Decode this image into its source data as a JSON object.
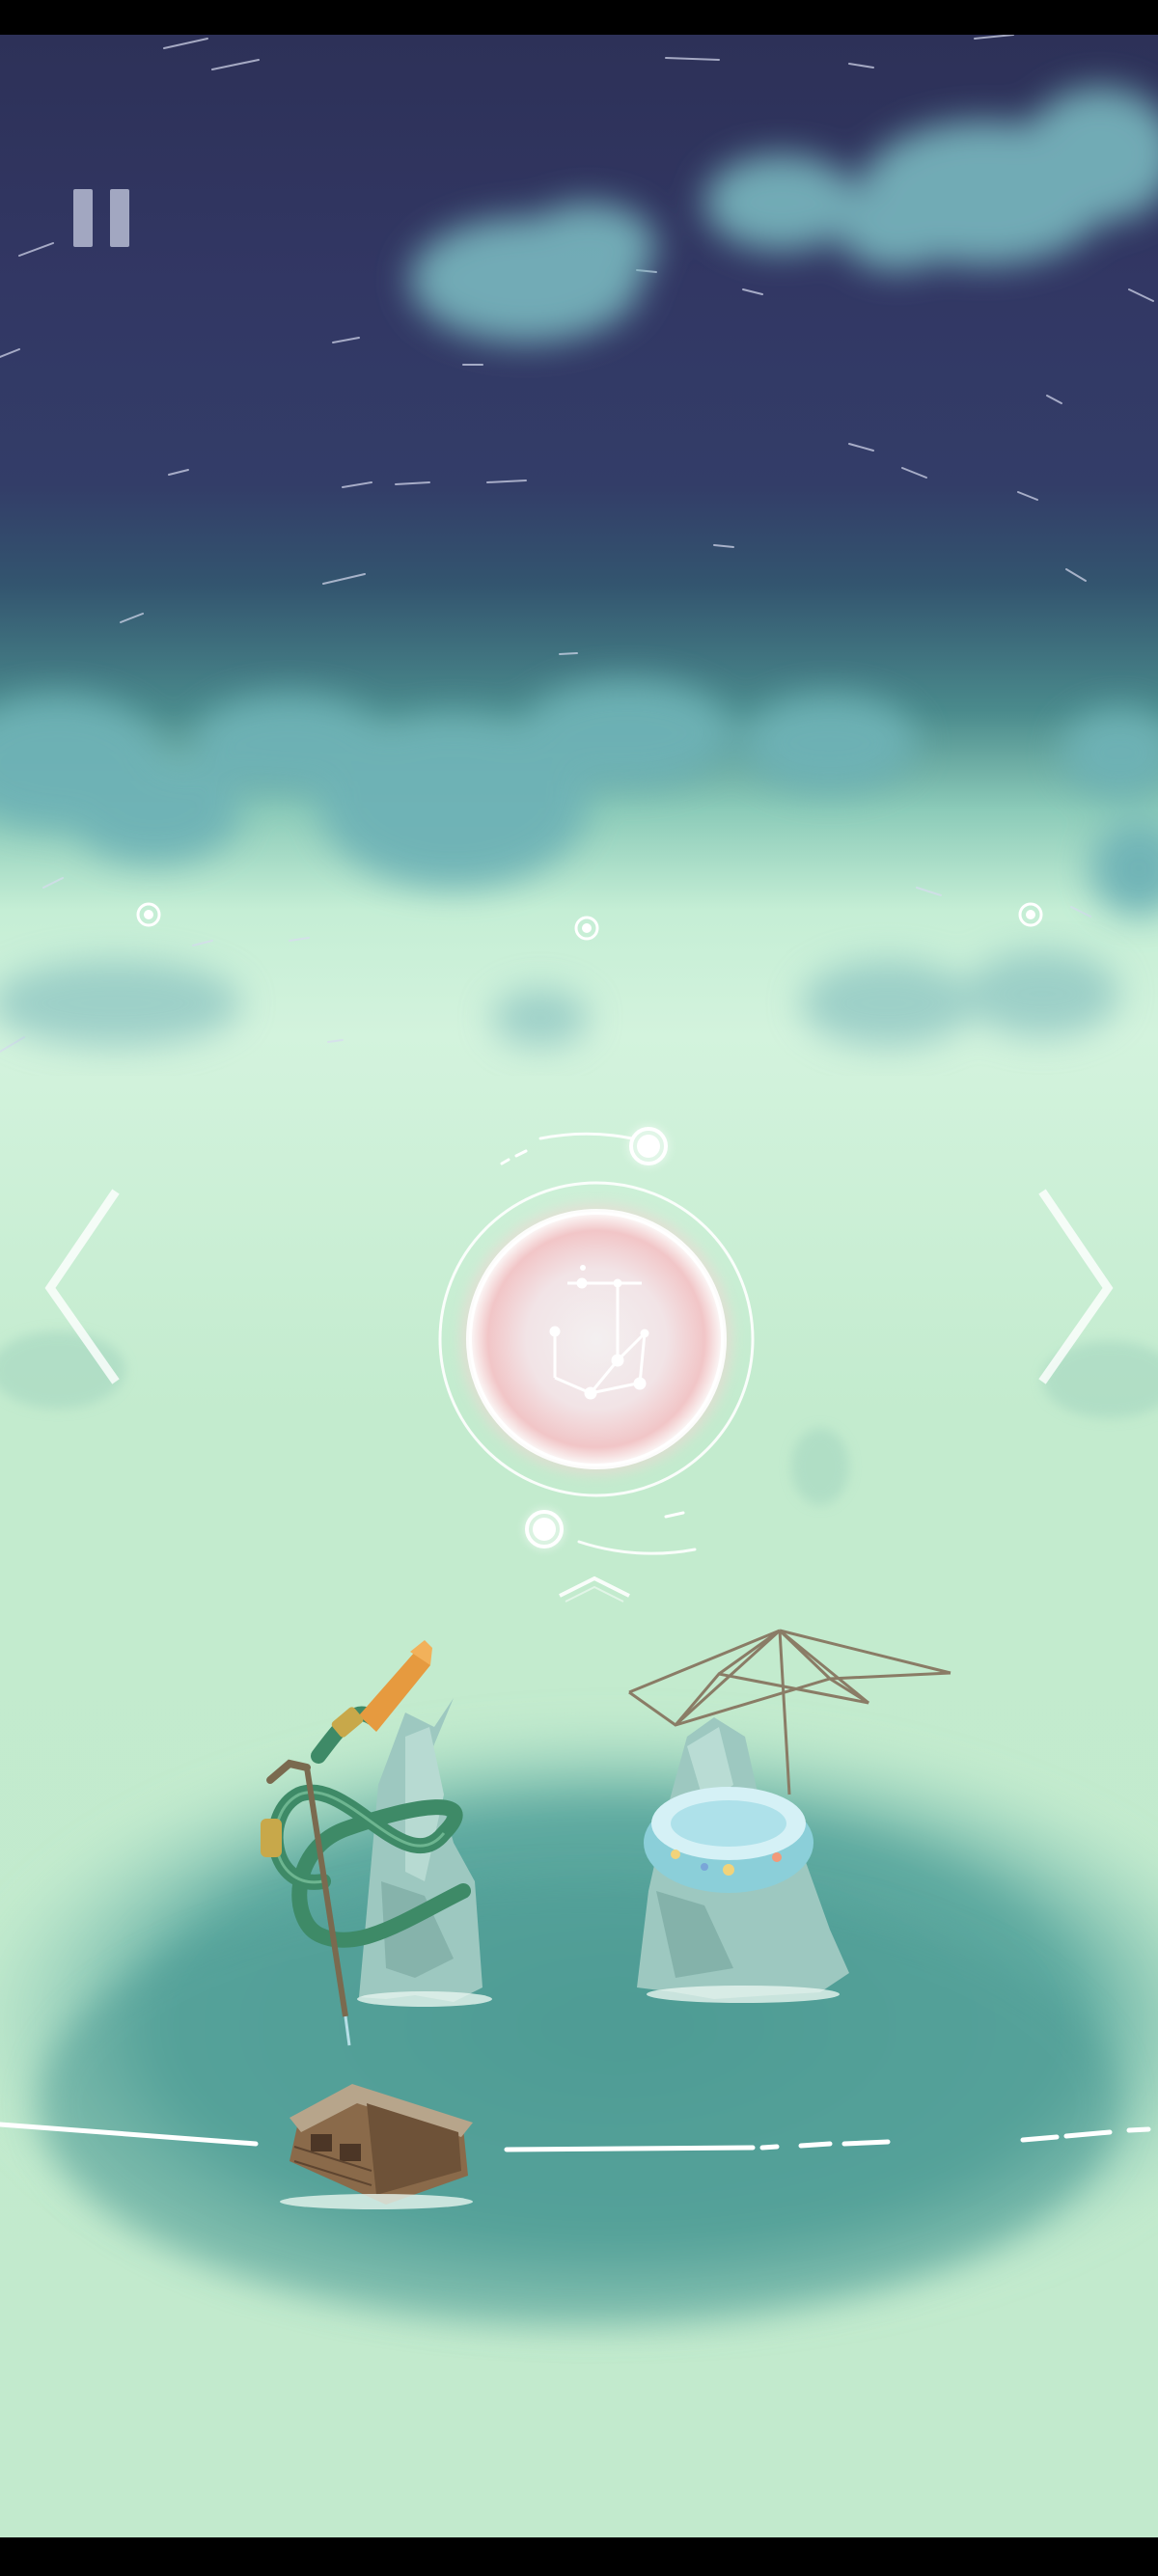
{
  "screen": {
    "type": "game-scene",
    "pause_icon": "pause-icon",
    "nav_left_icon": "chevron-left-icon",
    "nav_right_icon": "chevron-right-icon",
    "expand_icon": "chevron-up-icon",
    "constellation_icon": "constellation-icon",
    "sky_markers": 3,
    "objects": [
      "garden-hose",
      "rotary-clothesline",
      "inflatable-pool",
      "wooden-cabin"
    ]
  },
  "colors": {
    "sky_top": "#2f3560",
    "sky_mid": "#37607a",
    "horizon": "#c6eed6",
    "ground": "#c2ebce",
    "pond": "#5aa79e",
    "cloud": "#7bbcc0",
    "orb_ring": "#ffffff",
    "orb_glow": "#f2b6b9",
    "ui_white": "#ffffff",
    "bars": "#000000"
  }
}
